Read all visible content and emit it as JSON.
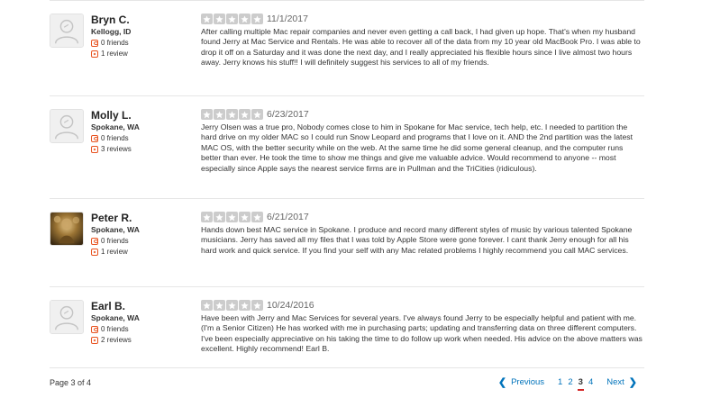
{
  "colors": {
    "star_empty": "#cccccc",
    "accent": "#e8521f",
    "link": "#0073bb",
    "current_page_underline": "#d32323"
  },
  "reviews": [
    {
      "name": "Bryn C.",
      "location": "Kellogg, ID",
      "friends": "0 friends",
      "reviews": "1 review",
      "avatar": "default-avatar-icon",
      "rating": 0,
      "date": "11/1/2017",
      "text": "After calling multiple Mac repair companies and never even getting a call back, I had given up hope. That's when my husband found Jerry at Mac Service and Rentals. He was able to recover all of the data from my 10 year old MacBook Pro. I was able to drop it off on a Saturday and it was done the next day, and I really appreciated his flexible hours since I live almost two hours away. Jerry knows his stuff!! I will definitely suggest his services to all of my friends."
    },
    {
      "name": "Molly L.",
      "location": "Spokane, WA",
      "friends": "0 friends",
      "reviews": "3 reviews",
      "avatar": "default-avatar-icon",
      "rating": 0,
      "date": "6/23/2017",
      "text": "Jerry Olsen was a true pro,   Nobody comes close to him in Spokane for Mac service, tech help, etc.  I needed to partition the hard drive on my older MAC so I could run Snow Leopard and programs that I love on it.  AND the 2nd partition was the latest MAC OS, with the better security while on the web. At the same time he did some general cleanup, and the computer runs better than ever. He took the time to show me things and give me valuable advice.  Would recommend to anyone -- most especially since Apple says the nearest service firms are in Pullman and the TriCities (ridiculous)."
    },
    {
      "name": "Peter R.",
      "location": "Spokane, WA",
      "friends": "0 friends",
      "reviews": "1 review",
      "avatar": "user-photo",
      "rating": 0,
      "date": "6/21/2017",
      "text": "Hands down best MAC service in Spokane. I produce and record many different styles of music by various talented Spokane musicians. Jerry has saved all my files that I was told by Apple Store were gone forever. I cant thank Jerry enough for all his hard work and quick service. If you find your self with any Mac related problems I highly recommend you call MAC services."
    },
    {
      "name": "Earl B.",
      "location": "Spokane, WA",
      "friends": "0 friends",
      "reviews": "2 reviews",
      "avatar": "default-avatar-icon",
      "rating": 0,
      "date": "10/24/2016",
      "text": "Have been with Jerry and Mac Services for several years.  I've always found Jerry to be especially helpful and patient with me. (I'm a Senior Citizen)  He has worked with me in purchasing parts; updating  and transferring data on three different computers.   I've been especially appreciative on his taking the time to do follow up work when needed. His advice on the above matters was excellent.  Highly recommend!  Earl B."
    }
  ],
  "pagination": {
    "label": "Page 3 of 4",
    "previous": "Previous",
    "next": "Next",
    "pages": [
      "1",
      "2",
      "3",
      "4"
    ],
    "current": "3"
  }
}
